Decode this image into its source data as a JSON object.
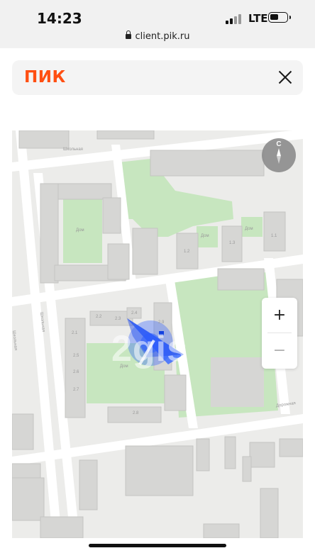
{
  "status_bar": {
    "time": "14:23",
    "network": "LTE",
    "url": "client.pik.ru",
    "battery_level": 0.45
  },
  "header": {
    "logo": "ПИК"
  },
  "map": {
    "compass_label": "С",
    "zoom_in": "+",
    "zoom_out": "−",
    "watermark": "2gis",
    "street_labels": [
      "Школьная",
      "Школьная",
      "Дорожная"
    ],
    "building_labels": [
      "Дом",
      "Дом",
      "Дом",
      "Дом"
    ],
    "house_numbers": [
      "2.1",
      "2.2",
      "2.3",
      "2.4",
      "2.5",
      "2.6",
      "2.7",
      "2.8",
      "1.1",
      "1.2",
      "1.3",
      "2.9"
    ],
    "colors": {
      "park": "#c7e6bf",
      "building": "#d6d6d4",
      "road": "#ffffff",
      "location": "#2b5cff"
    }
  }
}
